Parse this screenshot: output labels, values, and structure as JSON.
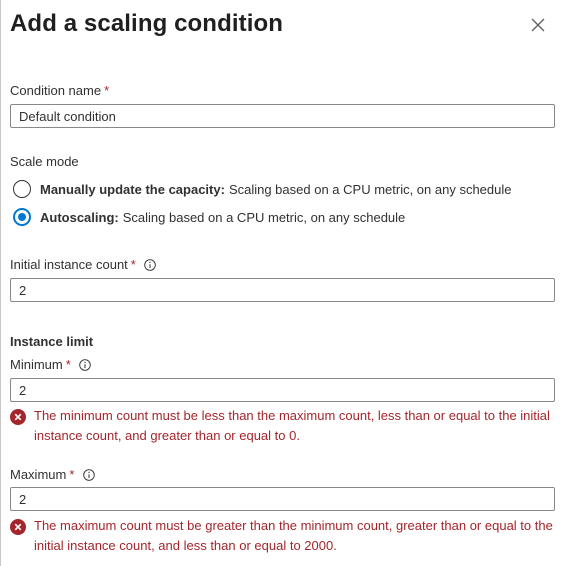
{
  "panel": {
    "title": "Add a scaling condition",
    "close_icon": "close-icon"
  },
  "condition_name": {
    "label": "Condition name",
    "required_mark": "*",
    "value": "Default condition"
  },
  "scale_mode": {
    "label": "Scale mode",
    "options": [
      {
        "bold": "Manually update the capacity:",
        "rest": "Scaling based on a CPU metric, on any schedule",
        "checked": false
      },
      {
        "bold": "Autoscaling:",
        "rest": "Scaling based on a CPU metric, on any schedule",
        "checked": true
      }
    ]
  },
  "initial_count": {
    "label": "Initial instance count",
    "required_mark": "*",
    "info_icon": "info-icon",
    "value": "2"
  },
  "instance_limit": {
    "heading": "Instance limit",
    "minimum": {
      "label": "Minimum",
      "required_mark": "*",
      "info_icon": "info-icon",
      "value": "2",
      "error": "The minimum count must be less than the maximum count, less than or equal to the initial instance count, and greater than or equal to 0."
    },
    "maximum": {
      "label": "Maximum",
      "required_mark": "*",
      "info_icon": "info-icon",
      "value": "2",
      "error": "The maximum count must be greater than the minimum count, greater than or equal to the initial instance count, and less than or equal to 2000."
    }
  },
  "colors": {
    "accent": "#0078d4",
    "error": "#a4262c",
    "text": "#323130",
    "border": "#8a8886"
  }
}
